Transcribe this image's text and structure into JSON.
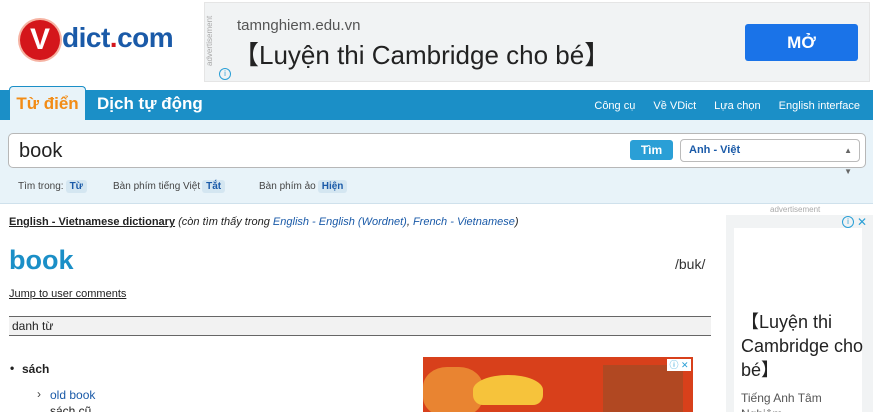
{
  "logo": {
    "mark": "V",
    "text": "dict",
    "dot": ".",
    "tld": "com"
  },
  "top_ad": {
    "vertical_label": "advertisement",
    "info": "i",
    "domain": "tamnghiem.edu.vn",
    "title": "【Luyện thi Cambridge cho bé】",
    "button": "MỞ"
  },
  "nav": {
    "tab_active": "Từ điển",
    "tab_other": "Dịch tự động",
    "links": [
      "Công cụ",
      "Về VDict",
      "Lựa chọn",
      "English interface"
    ]
  },
  "search": {
    "query": "book",
    "button": "Tìm",
    "language": "Anh - Việt",
    "options": [
      {
        "label": "Tìm trong:",
        "value": "Từ"
      },
      {
        "label": "Bàn phím tiếng Việt",
        "value": "Tắt"
      },
      {
        "label": "Bàn phím ảo",
        "value": "Hiện"
      }
    ]
  },
  "entry": {
    "dict_name": "English - Vietnamese dictionary",
    "also_found": "(còn tìm thấy trong",
    "also_links": [
      "English - English (Wordnet)",
      "French - Vietnamese"
    ],
    "also_end": ")",
    "word": "book",
    "phonetic": "/buk/",
    "jump": "Jump to user comments",
    "pos": "danh từ",
    "sense": "sách",
    "example_en": "old book",
    "example_vi": "sách cũ"
  },
  "right_ad": {
    "label": "advertisement",
    "info": "i",
    "close": "✕",
    "title": "【Luyện thi Cambridge cho bé】",
    "sub": "Tiếng Anh Tâm Nghiệm"
  },
  "mid_ad": {
    "close": "ⓘ ✕"
  },
  "colors": {
    "brand_blue": "#1b8fc7",
    "accent_orange": "#f28c16",
    "logo_red": "#d4161b"
  }
}
